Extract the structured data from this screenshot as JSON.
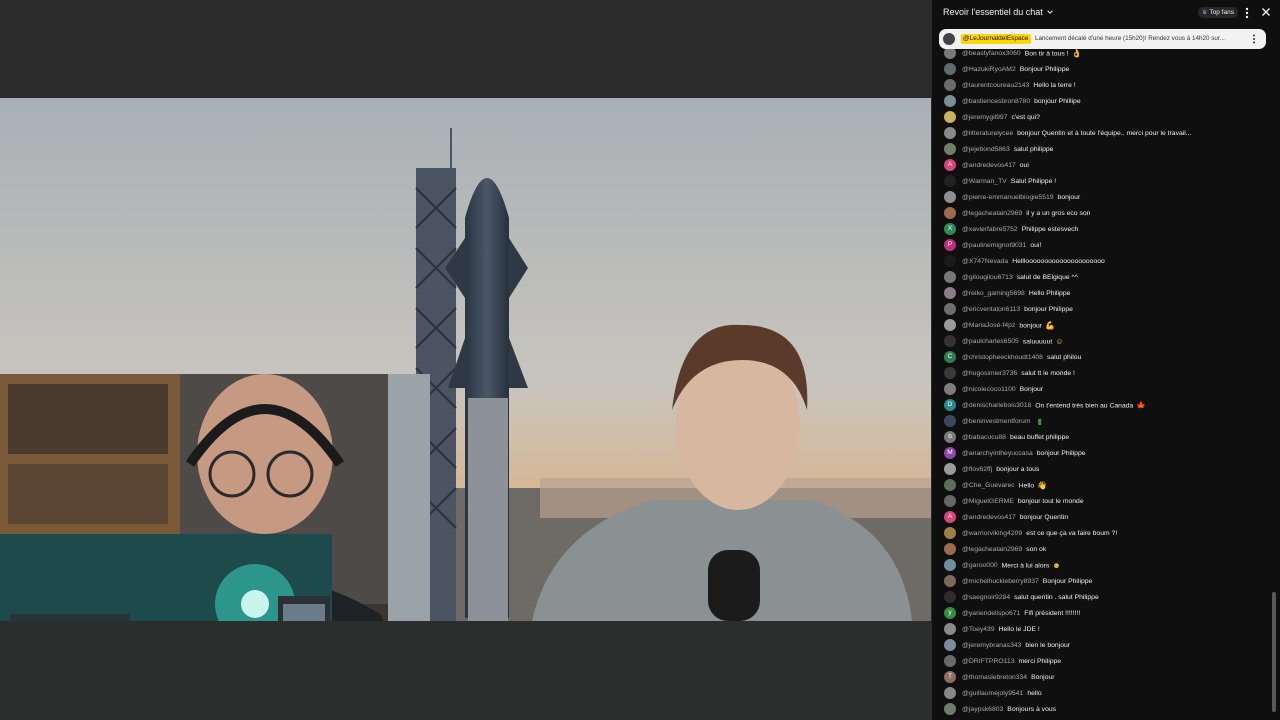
{
  "chat": {
    "title": "Revoir l'essentiel du chat",
    "top_fans_label": "Top fans",
    "pinned": {
      "author": "@LeJournaldelEspace",
      "text": "Lancement décalé d'une heure (15h20)! Rendez vous à 14h20 sur..."
    },
    "messages": [
      {
        "author": "@beastyfanox3060",
        "text": "Bon tir à tous !",
        "emoji": "ok-hand",
        "avatar_color": "#7a7a7a",
        "initial": ""
      },
      {
        "author": "@HazukiRyoAM2",
        "text": "Bonjour Philippe",
        "emoji": "",
        "avatar_color": "#5e6a70",
        "initial": ""
      },
      {
        "author": "@laurentcoureau2143",
        "text": "Hello la terre !",
        "emoji": "",
        "avatar_color": "#6b6b6b",
        "initial": ""
      },
      {
        "author": "@bastiencesbron8780",
        "text": "bonjour Phillipe",
        "emoji": "",
        "avatar_color": "#7b8d95",
        "initial": ""
      },
      {
        "author": "@jeremygil997",
        "text": "c'est qui?",
        "emoji": "",
        "avatar_color": "#c9b25a",
        "initial": ""
      },
      {
        "author": "@litteraturelycee",
        "text": "bonjour Quentin et à toute l'équipe.. merci pour le travail...",
        "emoji": "",
        "avatar_color": "#8a8a8a",
        "initial": ""
      },
      {
        "author": "@jejebond5863",
        "text": "salut philippe",
        "emoji": "",
        "avatar_color": "#6f7f6a",
        "initial": ""
      },
      {
        "author": "@andredevos417",
        "text": "oui",
        "emoji": "",
        "avatar_color": "#d6457a",
        "initial": "A"
      },
      {
        "author": "@Warman_TV",
        "text": "Salut Philippe !",
        "emoji": "",
        "avatar_color": "#222222",
        "initial": ""
      },
      {
        "author": "@pierre-emmanuelbiogie5519",
        "text": "bonjour",
        "emoji": "",
        "avatar_color": "#8e8e8e",
        "initial": ""
      },
      {
        "author": "@legachealain2969",
        "text": "il y a un gros eco son",
        "emoji": "",
        "avatar_color": "#9b6b4c",
        "initial": ""
      },
      {
        "author": "@xavierfabre5752",
        "text": "Philippe estesvech",
        "emoji": "",
        "avatar_color": "#2e8b57",
        "initial": "X"
      },
      {
        "author": "@paulinemignot9031",
        "text": "oui!",
        "emoji": "",
        "avatar_color": "#c0307a",
        "initial": "P"
      },
      {
        "author": "@X747Nevada",
        "text": "Helllooooooooooooooooooooo",
        "emoji": "",
        "avatar_color": "#1a1a1a",
        "initial": ""
      },
      {
        "author": "@gilougilou6713",
        "text": "salut de BElgique ^^",
        "emoji": "",
        "avatar_color": "#777777",
        "initial": ""
      },
      {
        "author": "@reiko_gaming5698",
        "text": "Hello Philippe",
        "emoji": "",
        "avatar_color": "#8c7b8a",
        "initial": ""
      },
      {
        "author": "@ericventalon6113",
        "text": "bonjour Philippe",
        "emoji": "",
        "avatar_color": "#6e6e6e",
        "initial": ""
      },
      {
        "author": "@MariaJosé-f4pz",
        "text": "bonjour",
        "emoji": "muscle",
        "avatar_color": "#9a9a9a",
        "initial": ""
      },
      {
        "author": "@paulcharles6505",
        "text": "saluuuuut",
        "emoji": "smile",
        "avatar_color": "#333333",
        "initial": ""
      },
      {
        "author": "@christopheeckhoudt1408",
        "text": "salut philou",
        "emoji": "",
        "avatar_color": "#2f7d4f",
        "initial": "C"
      },
      {
        "author": "@hugosimier3736",
        "text": "salut tt le monde !",
        "emoji": "",
        "avatar_color": "#3a3a3a",
        "initial": ""
      },
      {
        "author": "@nicolecoco1100",
        "text": "Bonjour",
        "emoji": "",
        "avatar_color": "#7c7c7c",
        "initial": ""
      },
      {
        "author": "@denischarlebois3018",
        "text": "On t'entend très bien au Canada",
        "emoji": "flag-ca",
        "avatar_color": "#2a8a8a",
        "initial": "D"
      },
      {
        "author": "@beninvestmentforum",
        "text": "",
        "emoji": "flag-bj",
        "avatar_color": "#3b4a5a",
        "initial": ""
      },
      {
        "author": "@babacucu88",
        "text": "beau buffet philippe",
        "emoji": "",
        "avatar_color": "#7a7a7a",
        "initial": "b"
      },
      {
        "author": "@anarchyintheyuccasa",
        "text": "bonjour Philippe",
        "emoji": "",
        "avatar_color": "#8e44ad",
        "initial": "M"
      },
      {
        "author": "@flov62ffj",
        "text": "bonjour a tous",
        "emoji": "",
        "avatar_color": "#9a9a9a",
        "initial": ""
      },
      {
        "author": "@Che_Guevarec",
        "text": "Hello",
        "emoji": "wave",
        "avatar_color": "#5b6f5b",
        "initial": ""
      },
      {
        "author": "@MiguelGERME",
        "text": "bonjour tout le monde",
        "emoji": "",
        "avatar_color": "#666666",
        "initial": ""
      },
      {
        "author": "@andredevos417",
        "text": "bonjour Quentin",
        "emoji": "",
        "avatar_color": "#d6457a",
        "initial": "A"
      },
      {
        "author": "@warriorviking4209",
        "text": "est ce que ça va faire boum ?!",
        "emoji": "",
        "avatar_color": "#a08040",
        "initial": ""
      },
      {
        "author": "@legachealain2969",
        "text": "son ok",
        "emoji": "",
        "avatar_color": "#9b6b4c",
        "initial": ""
      },
      {
        "author": "@garoo000",
        "text": "Merci à lui alors",
        "emoji": "grin",
        "avatar_color": "#6f8fa0",
        "initial": ""
      },
      {
        "author": "@michelhuckleberry8937",
        "text": "Bonjour Philippe",
        "emoji": "",
        "avatar_color": "#7a6a5a",
        "initial": ""
      },
      {
        "author": "@saegnoir9284",
        "text": "salut quentin . salut Philippe",
        "emoji": "",
        "avatar_color": "#2d2d2d",
        "initial": ""
      },
      {
        "author": "@yariendelispo671",
        "text": "Fifi président !!!!!!!!",
        "emoji": "",
        "avatar_color": "#2f8f3f",
        "initial": "y"
      },
      {
        "author": "@Toey439",
        "text": "Hello le JDE !",
        "emoji": "",
        "avatar_color": "#8a8a8a",
        "initial": ""
      },
      {
        "author": "@jeremybranas343",
        "text": "bien le bonjour",
        "emoji": "",
        "avatar_color": "#7d8c9b",
        "initial": ""
      },
      {
        "author": "@DRIFTPRO113",
        "text": "merci Philippe",
        "emoji": "",
        "avatar_color": "#6a6a6a",
        "initial": ""
      },
      {
        "author": "@thomaslebreton334",
        "text": "Bonjour",
        "emoji": "",
        "avatar_color": "#8d6e63",
        "initial": "T"
      },
      {
        "author": "@guillaumejoly9541",
        "text": "hello",
        "emoji": "",
        "avatar_color": "#888888",
        "initial": ""
      },
      {
        "author": "@jaypsk6803",
        "text": "Bonjours à vous",
        "emoji": "",
        "avatar_color": "#6d7d6d",
        "initial": ""
      }
    ]
  },
  "colors": {
    "chat_bg": "#0f0f0f",
    "author_name": "#aaaaaa",
    "message_text": "#f1f1f1",
    "pinned_highlight": "#ffd600"
  }
}
